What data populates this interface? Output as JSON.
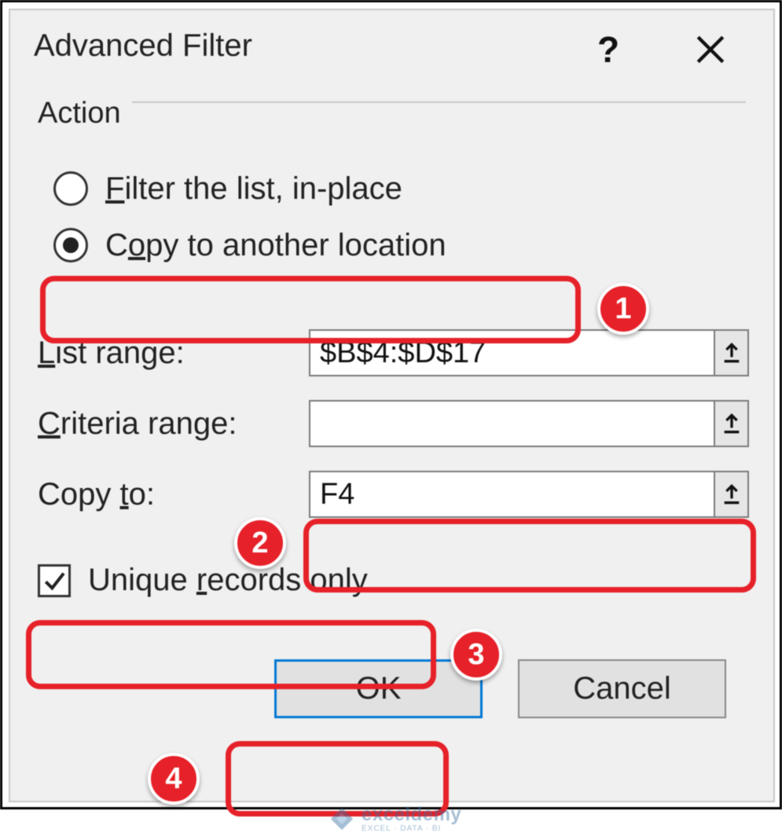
{
  "titlebar": {
    "title": "Advanced Filter",
    "help": "?",
    "close_icon": "close-icon"
  },
  "action_group": {
    "legend": "Action",
    "radios": {
      "filter_in_place": {
        "pre": "",
        "u": "F",
        "post": "ilter the list, in-place",
        "selected": false
      },
      "copy_to_location": {
        "pre": "C",
        "u": "o",
        "post": "py to another location",
        "selected": true
      }
    }
  },
  "fields": {
    "list_range": {
      "pre": "",
      "u": "L",
      "post": "ist range:",
      "value": "$B$4:$D$17"
    },
    "criteria_range": {
      "pre": "",
      "u": "C",
      "post": "riteria range:",
      "value": ""
    },
    "copy_to": {
      "pre": "Copy ",
      "u": "t",
      "post": "o:",
      "value": "F4"
    }
  },
  "checkbox": {
    "pre": "Unique ",
    "u": "r",
    "post": "ecords only",
    "checked": true
  },
  "buttons": {
    "ok": "OK",
    "cancel": "Cancel"
  },
  "callouts": {
    "c1": "1",
    "c2": "2",
    "c3": "3",
    "c4": "4"
  },
  "watermark": {
    "name": "exceldemy",
    "sub": "EXCEL · DATA · BI"
  }
}
